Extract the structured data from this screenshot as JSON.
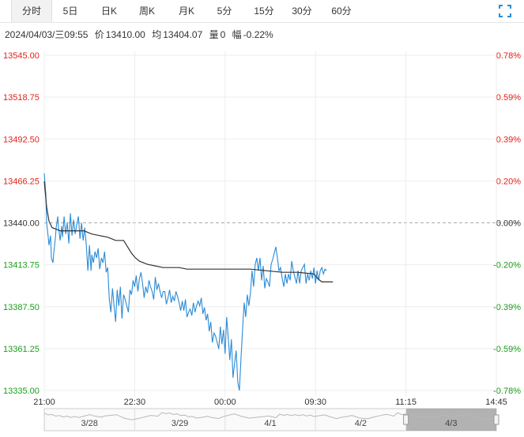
{
  "tabs": [
    {
      "label": "分时",
      "active": true
    },
    {
      "label": "5日"
    },
    {
      "label": "日K"
    },
    {
      "label": "周K"
    },
    {
      "label": "月K"
    },
    {
      "label": "5分"
    },
    {
      "label": "15分"
    },
    {
      "label": "30分"
    },
    {
      "label": "60分"
    }
  ],
  "info": {
    "datetime": "2024/04/03/三09:55",
    "price_label": "价",
    "price": "13410.00",
    "avg_label": "均",
    "avg": "13404.07",
    "vol_label": "量",
    "vol": "0",
    "chg_label": "幅",
    "chg": "-0.22%"
  },
  "colors": {
    "up": "#e2231a",
    "down": "#1a9e1a",
    "price_line": "#2b8bd6",
    "avg_line": "#333333"
  },
  "chart_data": {
    "type": "line",
    "base_price": 13440.0,
    "ylim": [
      13335.0,
      13545.0
    ],
    "y_ticks_left": [
      "13545.00",
      "13518.75",
      "13492.50",
      "13466.25",
      "13440.00",
      "13413.75",
      "13387.50",
      "13361.25",
      "13335.00"
    ],
    "y_ticks_right": [
      "0.78%",
      "0.59%",
      "0.39%",
      "0.20%",
      "0.00%",
      "-0.20%",
      "-0.39%",
      "-0.59%",
      "-0.78%"
    ],
    "x_ticks": [
      "21:00",
      "22:30",
      "00:00",
      "09:30",
      "11:15",
      "14:45"
    ],
    "x_range": [
      0,
      570
    ],
    "price_series": {
      "x": [
        0,
        2,
        3,
        5,
        6,
        8,
        9,
        11,
        12,
        14,
        15,
        17,
        18,
        20,
        22,
        23,
        25,
        27,
        29,
        31,
        33,
        35,
        37,
        39,
        41,
        43,
        45,
        47,
        49,
        51,
        53,
        55,
        57,
        59,
        60,
        62,
        64,
        66,
        68,
        70,
        72,
        74,
        76,
        78,
        80,
        82,
        84,
        86,
        88,
        90,
        92,
        94,
        96,
        98,
        100,
        102,
        104,
        106,
        108,
        110,
        112,
        114,
        116,
        118,
        120,
        122,
        124,
        126,
        128,
        130,
        132,
        134,
        136,
        138,
        140,
        142,
        144,
        146,
        148,
        150,
        152,
        154,
        156,
        158,
        160,
        162,
        164,
        166,
        168,
        170,
        172,
        174,
        176,
        178,
        180,
        182,
        184,
        186,
        188,
        190,
        192,
        194,
        196,
        198,
        200,
        202,
        204,
        206,
        208,
        210,
        212,
        214,
        216,
        218,
        220,
        222,
        224,
        226,
        228,
        230,
        232,
        234,
        236,
        238,
        240,
        242,
        244,
        246,
        248,
        250,
        252,
        254,
        256,
        258,
        260,
        262,
        264,
        266,
        268,
        270,
        272,
        274,
        276,
        278,
        280,
        282,
        284,
        286,
        288,
        290,
        292,
        294,
        296,
        298,
        300,
        302,
        304,
        306,
        308,
        310,
        312,
        314,
        316,
        318,
        320,
        322,
        324,
        326,
        328,
        330,
        332,
        334,
        336,
        338,
        340,
        342,
        344,
        346,
        348,
        350,
        352,
        354,
        356,
        357,
        358,
        359,
        360,
        362,
        364
      ],
      "y": [
        13471,
        13458,
        13440,
        13431,
        13426,
        13432,
        13418,
        13415,
        13421,
        13430,
        13437,
        13444,
        13437,
        13429,
        13438,
        13431,
        13444,
        13433,
        13440,
        13427,
        13446,
        13432,
        13442,
        13433,
        13439,
        13444,
        13430,
        13440,
        13429,
        13437,
        13426,
        13410,
        13426,
        13410,
        13420,
        13415,
        13422,
        13418,
        13424,
        13411,
        13418,
        13415,
        13422,
        13409,
        13412,
        13392,
        13384,
        13399,
        13388,
        13378,
        13398,
        13388,
        13400,
        13380,
        13395,
        13392,
        13388,
        13384,
        13398,
        13395,
        13404,
        13400,
        13407,
        13397,
        13405,
        13409,
        13402,
        13393,
        13400,
        13396,
        13404,
        13400,
        13397,
        13392,
        13406,
        13398,
        13402,
        13397,
        13393,
        13397,
        13397,
        13389,
        13393,
        13398,
        13390,
        13394,
        13391,
        13397,
        13394,
        13390,
        13385,
        13391,
        13385,
        13392,
        13381,
        13384,
        13386,
        13382,
        13390,
        13384,
        13388,
        13391,
        13388,
        13393,
        13383,
        13387,
        13379,
        13383,
        13372,
        13378,
        13365,
        13371,
        13369,
        13365,
        13361,
        13375,
        13364,
        13373,
        13358,
        13381,
        13368,
        13354,
        13367,
        13343,
        13352,
        13360,
        13340,
        13335,
        13355,
        13373,
        13390,
        13381,
        13395,
        13388,
        13396,
        13410,
        13400,
        13414,
        13418,
        13410,
        13418,
        13404,
        13413,
        13399,
        13405,
        13403,
        13400,
        13414,
        13417,
        13421,
        13425,
        13418,
        13410,
        13412,
        13405,
        13400,
        13408,
        13402,
        13408,
        13404,
        13416,
        13410,
        13406,
        13402,
        13410,
        13402,
        13410,
        13412,
        13414,
        13402,
        13408,
        13404,
        13410,
        13405,
        13412,
        13402,
        13410,
        13404,
        13410,
        13412,
        13408,
        13411,
        13410
      ]
    },
    "avg_series": {
      "x": [
        0,
        3,
        6,
        10,
        15,
        20,
        25,
        30,
        40,
        50,
        60,
        70,
        80,
        90,
        100,
        110,
        115,
        120,
        130,
        140,
        150,
        160,
        170,
        180,
        190,
        200,
        220,
        240,
        260,
        280,
        300,
        320,
        340,
        345,
        350,
        355,
        360,
        364
      ],
      "y": [
        13466,
        13450,
        13441,
        13437,
        13436,
        13435,
        13435,
        13435,
        13435,
        13435,
        13433,
        13432,
        13431,
        13429,
        13429,
        13421,
        13418,
        13416,
        13414,
        13413,
        13412,
        13412,
        13412,
        13411,
        13411,
        13411,
        13411,
        13411,
        13411,
        13410,
        13409,
        13409,
        13408,
        13405,
        13403,
        13403,
        13403,
        13403
      ]
    },
    "navigator": {
      "day_labels": [
        "3/28",
        "3/29",
        "4/1",
        "4/2",
        "4/3"
      ],
      "selected_day": "4/3"
    }
  }
}
